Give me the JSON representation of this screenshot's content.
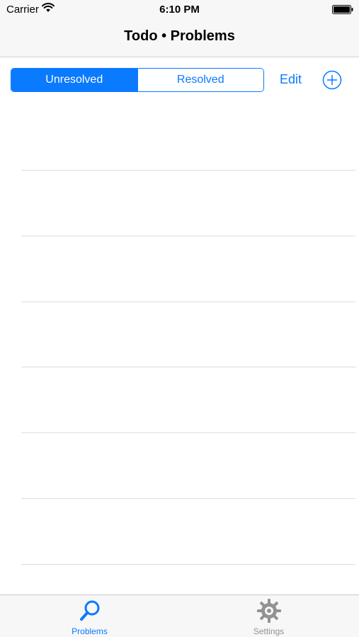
{
  "status_bar": {
    "carrier": "Carrier",
    "time": "6:10 PM",
    "wifi_icon": "wifi-icon",
    "battery_icon": "battery-icon"
  },
  "nav": {
    "title": "Todo • Problems"
  },
  "toolbar": {
    "segments": [
      {
        "label": "Unresolved",
        "selected": true
      },
      {
        "label": "Resolved",
        "selected": false
      }
    ],
    "edit_label": "Edit",
    "add_icon": "plus-circle-icon"
  },
  "table": {
    "row_count": 7
  },
  "tab_bar": {
    "tabs": [
      {
        "label": "Problems",
        "icon": "search-icon",
        "active": true
      },
      {
        "label": "Settings",
        "icon": "gear-icon",
        "active": false
      }
    ]
  },
  "colors": {
    "accent": "#0a7aff",
    "inactive": "#929292",
    "bar_background": "#f7f7f8"
  }
}
